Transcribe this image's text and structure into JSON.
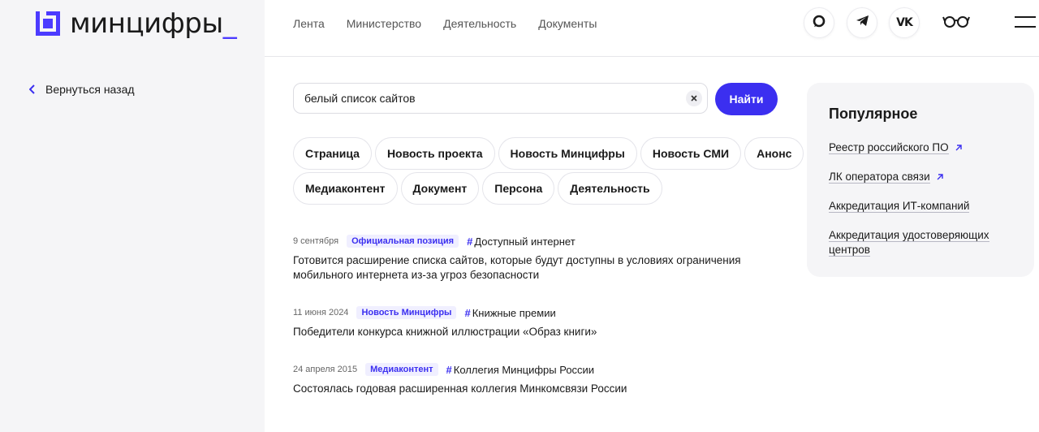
{
  "header": {
    "logo_text": "минцифры",
    "logo_underscore": "_",
    "nav": [
      "Лента",
      "Министерство",
      "Деятельность",
      "Документы"
    ],
    "social_icons": [
      "max-icon",
      "telegram-icon",
      "vk-icon"
    ]
  },
  "back": {
    "label": "Вернуться назад"
  },
  "search": {
    "value": "белый список сайтов",
    "button": "Найти"
  },
  "filters": {
    "row1": [
      "Страница",
      "Новость проекта",
      "Новость Минцифры",
      "Новость СМИ",
      "Анонс"
    ],
    "row2": [
      "Медиаконтент",
      "Документ",
      "Персона",
      "Деятельность"
    ]
  },
  "results": [
    {
      "date": "9 сентября",
      "type": "Официальная позиция",
      "hashtag": "Доступный интернет",
      "title": "Готовится расширение списка сайтов, которые будут доступны в условиях ограничения мобильного интернета из-за угроз безопасности"
    },
    {
      "date": "11 июня 2024",
      "type": "Новость Минцифры",
      "hashtag": "Книжные премии",
      "title": "Победители конкурса книжной иллюстрации «Образ книги»"
    },
    {
      "date": "24 апреля 2015",
      "type": "Медиаконтент",
      "hashtag": "Коллегия Минцифры России",
      "title": "Состоялась годовая расширенная коллегия Минкомсвязи России"
    }
  ],
  "popular": {
    "title": "Популярное",
    "links": [
      {
        "label": "Реестр российского ПО",
        "external": true
      },
      {
        "label": "ЛК оператора связи",
        "external": true
      },
      {
        "label": "Аккредитация ИТ-компаний",
        "external": false
      },
      {
        "label": "Аккредитация удостоверяющих центров",
        "external": false
      }
    ]
  },
  "colors": {
    "accent": "#3b2ff0",
    "panel": "#f5f5f7"
  }
}
